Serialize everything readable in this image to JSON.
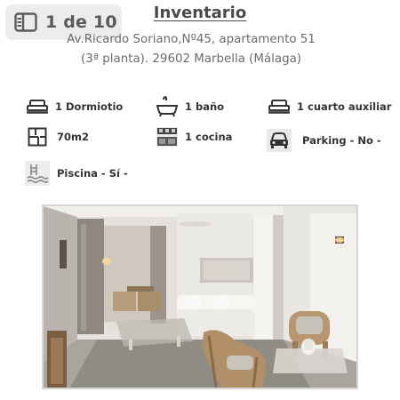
{
  "gallery": {
    "counter": "1 de 10"
  },
  "header": {
    "title": "Inventario",
    "address_line1": "Av.Ricardo Soriano,Nº45, apartamento 51",
    "address_line2": "(3ª planta). 29602 Marbella (Málaga)"
  },
  "features": [
    {
      "icon": "bed-icon",
      "label": "1 Dormiotio"
    },
    {
      "icon": "bathtub-icon",
      "label": "1 baño"
    },
    {
      "icon": "bed-icon",
      "label": "1 cuarto auxiliar"
    },
    {
      "icon": "floor-plan-icon",
      "label": "70m2"
    },
    {
      "icon": "kitchen-icon",
      "label": "1 cocina"
    },
    {
      "icon": "car-icon",
      "label": "Parking - No -"
    },
    {
      "icon": "pool-icon",
      "label": "Piscina - Sí -"
    }
  ],
  "photo": {
    "subject": "living-room-photo"
  },
  "colors": {
    "text": "#333333",
    "muted": "#6a6a6a",
    "badge_bg": "#ebebeb"
  }
}
